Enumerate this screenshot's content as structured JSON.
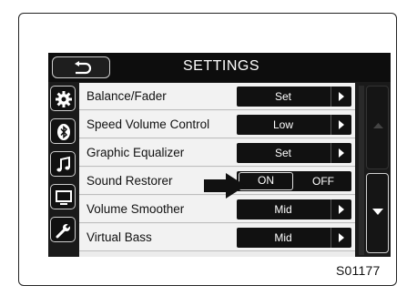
{
  "header": {
    "title": "SETTINGS"
  },
  "sidebar": {
    "icons": [
      "gear-icon",
      "bluetooth-icon",
      "music-note-icon",
      "display-icon",
      "wrench-icon"
    ]
  },
  "settings": {
    "rows": [
      {
        "label": "Balance/Fader",
        "value": "Set"
      },
      {
        "label": "Speed Volume Control",
        "value": "Low"
      },
      {
        "label": "Graphic Equalizer",
        "value": "Set"
      },
      {
        "label": "Sound Restorer",
        "on_label": "ON",
        "off_label": "OFF",
        "selected": "ON"
      },
      {
        "label": "Volume Smoother",
        "value": "Mid"
      },
      {
        "label": "Virtual Bass",
        "value": "Mid"
      }
    ]
  },
  "figure_code": "S01177",
  "colors": {
    "screen_bg": "#1a1a1a",
    "row_bg": "#f2f2f2",
    "button_bg": "#111111",
    "text_light": "#ffffff"
  }
}
